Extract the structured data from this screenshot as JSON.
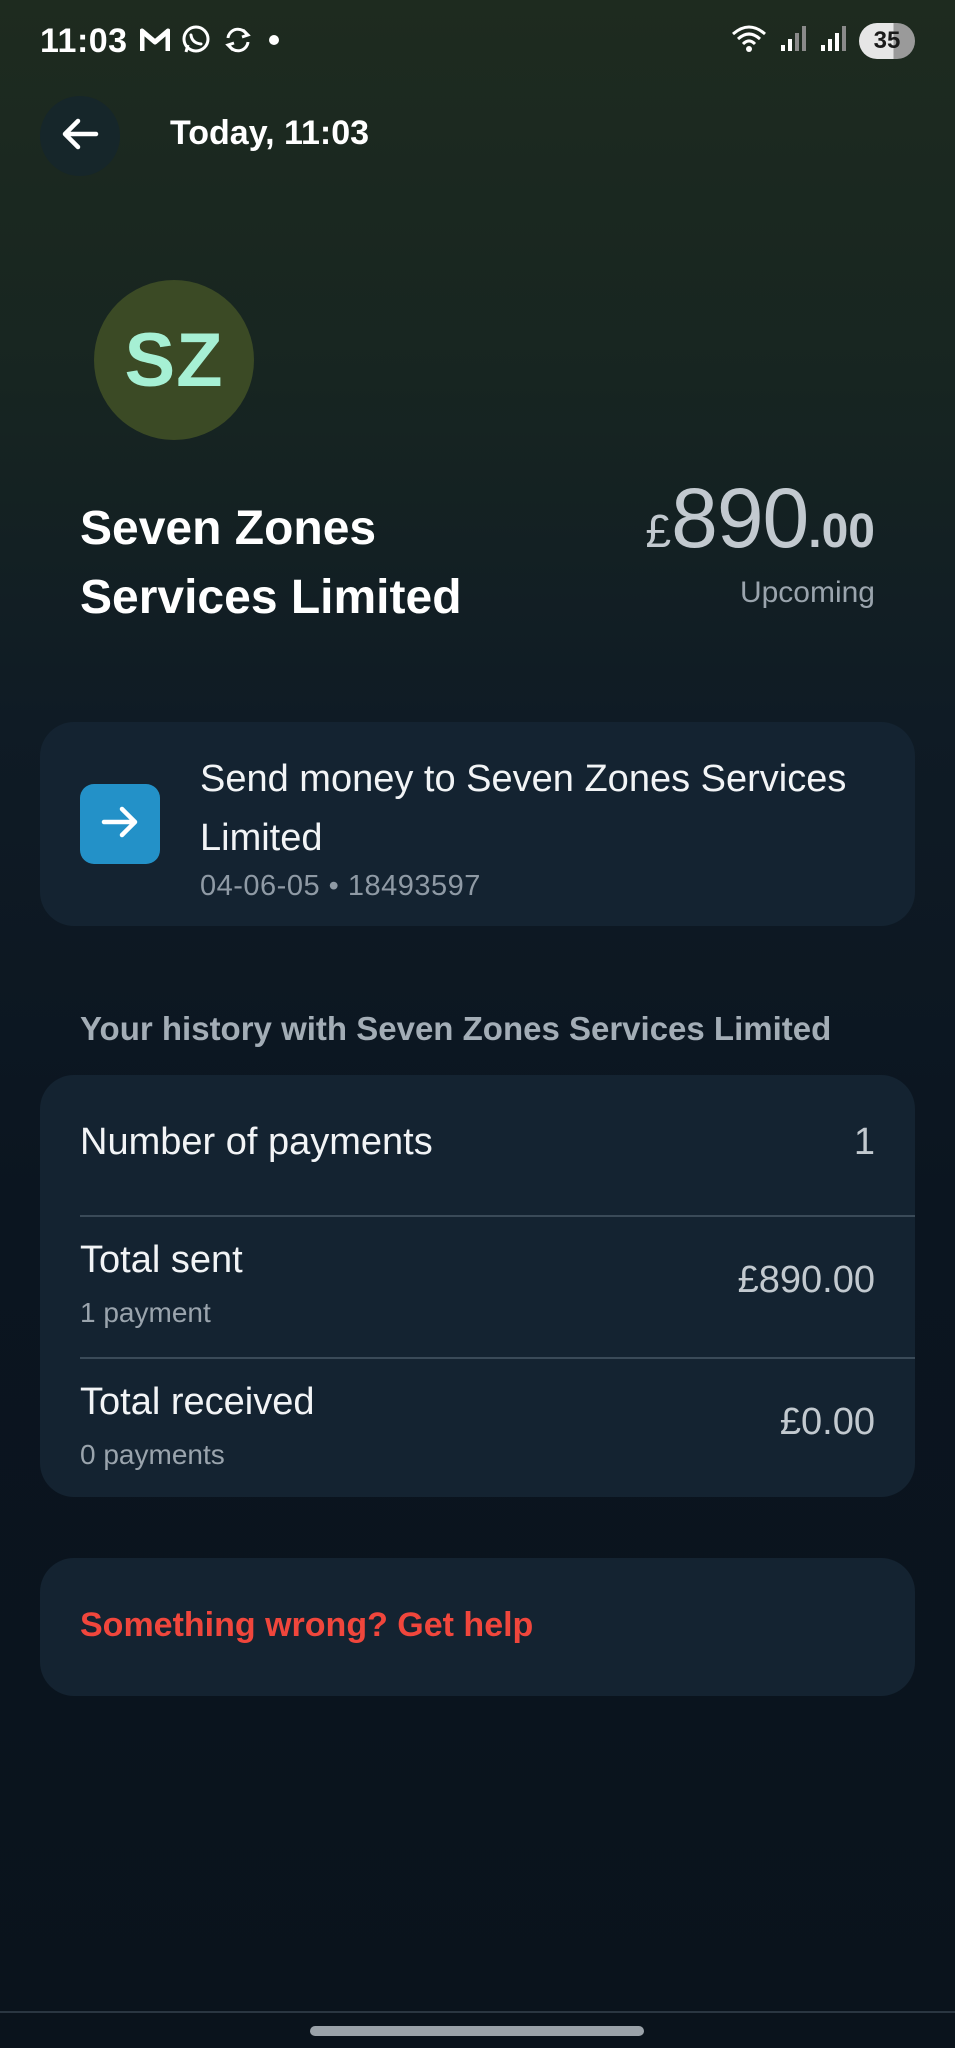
{
  "status_bar": {
    "time": "11:03",
    "icons_left": [
      "gmail-icon",
      "whatsapp-icon",
      "sync-icon",
      "dot-icon"
    ],
    "icons_right": [
      "wifi-icon",
      "signal-icon",
      "signal-icon"
    ],
    "battery": "35"
  },
  "header": {
    "title": "Today, 11:03"
  },
  "payee": {
    "initials": "SZ",
    "name": "Seven Zones Services Limited",
    "avatar_color": "#3b4a25",
    "initials_color": "#a6f0d4"
  },
  "amount": {
    "currency": "£",
    "major": "890",
    "minor": ".00",
    "status": "Upcoming"
  },
  "send_card": {
    "title": "Send money to Seven Zones Services Limited",
    "details": "04-06-05 • 18493597",
    "icon": "arrow-right-icon",
    "icon_bg": "#2391c8"
  },
  "history": {
    "heading": "Your history with Seven Zones Services Limited",
    "rows": [
      {
        "label": "Number of payments",
        "value": "1"
      },
      {
        "label": "Total sent",
        "sub": "1 payment",
        "value": "£890.00"
      },
      {
        "label": "Total received",
        "sub": "0 payments",
        "value": "£0.00"
      }
    ]
  },
  "help": {
    "text": "Something wrong? Get help",
    "color": "#f0463c"
  }
}
